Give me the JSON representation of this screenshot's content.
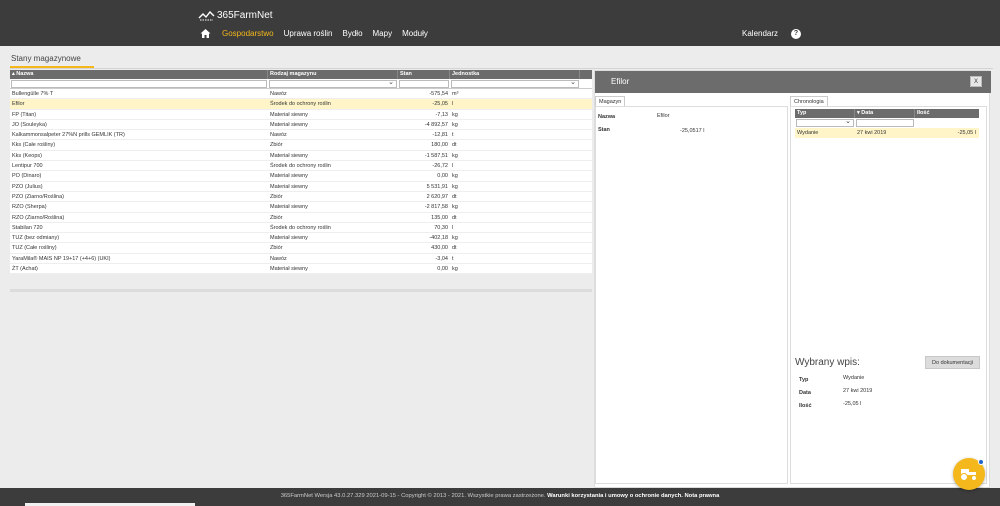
{
  "app": {
    "brand": "365FarmNet"
  },
  "nav": {
    "items": [
      "Gospodarstwo",
      "Uprawa roślin",
      "Bydło",
      "Mapy",
      "Moduły"
    ],
    "active": "Gospodarstwo",
    "calendar": "Kalendarz",
    "help": "?"
  },
  "page": {
    "title": "Stany magazynowe"
  },
  "grid": {
    "columns": [
      "Nazwa",
      "Rodzaj magazynu",
      "Stan",
      "Jednostka"
    ],
    "rows": [
      [
        "Bullengülle 7% T",
        "Nawóz",
        "-575,54",
        "m³"
      ],
      [
        "Efilor",
        "Środek do ochrony roślin",
        "-25,05",
        "l"
      ],
      [
        "FP (Titan)",
        "Materiał siewny",
        "-7,13",
        "kg"
      ],
      [
        "JO (Souleyka)",
        "Materiał siewny",
        "-4 892,57",
        "kg"
      ],
      [
        "Kalkammonsalpeter 27%N prills GEMLIK (TR)",
        "Nawóz",
        "-12,81",
        "t"
      ],
      [
        "Kks (Całe rośliny)",
        "Zbiór",
        "180,00",
        "dt"
      ],
      [
        "Kks (Keops)",
        "Materiał siewny",
        "-1 587,51",
        "kg"
      ],
      [
        "Lentipur 700",
        "Środek do ochrony roślin",
        "-26,72",
        "l"
      ],
      [
        "PO (Dinaro)",
        "Materiał siewny",
        "0,00",
        "kg"
      ],
      [
        "PZO (Julius)",
        "Materiał siewny",
        "5 531,91",
        "kg"
      ],
      [
        "PZO (Ziarno/Roślina)",
        "Zbiór",
        "2 620,97",
        "dt"
      ],
      [
        "RZO (Sherpa)",
        "Materiał siewny",
        "-2 817,58",
        "kg"
      ],
      [
        "RZO (Ziarno/Roślina)",
        "Zbiór",
        "135,00",
        "dt"
      ],
      [
        "Stabilan 720",
        "Środek do ochrony roślin",
        "70,30",
        "l"
      ],
      [
        "TUZ (bez odmiany)",
        "Materiał siewny",
        "-402,18",
        "kg"
      ],
      [
        "TUZ (Całe rośliny)",
        "Zbiór",
        "430,00",
        "dt"
      ],
      [
        "YaraMila® MAIS NP 19+17 (+4+6) (UKI)",
        "Nawóz",
        "-3,04",
        "t"
      ],
      [
        "ŻT (Achat)",
        "Materiał siewny",
        "0,00",
        "kg"
      ]
    ],
    "selected_index": 1
  },
  "detail": {
    "title": "Efilor",
    "close": "X",
    "tab_left": "Magazyn",
    "tab_right": "Chronologia",
    "nazwa_label": "Nazwa",
    "nazwa_value": "Efilor",
    "stan_label": "Stan",
    "stan_value": "-25,0517 l",
    "history": {
      "columns": [
        "Typ",
        "Data",
        "Ilość"
      ],
      "rows": [
        [
          "Wydanie",
          "27 kwi 2019",
          "-25,05 l"
        ]
      ]
    },
    "selected_entry": {
      "title": "Wybrany wpis:",
      "button": "Do dokumentacji",
      "typ_label": "Typ",
      "typ_value": "Wydanie",
      "data_label": "Data",
      "data_value": "27 kwi 2019",
      "ilosc_label": "Ilość",
      "ilosc_value": "-25,05 l"
    }
  },
  "footer": {
    "text": "365FarmNet Wersja 43.0.27.329 2021-09-15 - Copyright © 2013 - 2021. Wszystkie prawa zastrzeżone.",
    "link1": "Warunki korzystania i umowy o ochronie danych.",
    "link2": "Nota prawna"
  },
  "colors": {
    "accent": "#f5b81c",
    "header_bg": "#3c3c3c",
    "selected_row": "#fff5c8",
    "fab_dot": "#1e63c8"
  },
  "icons": [
    "farm-logo-icon",
    "home-icon",
    "help-icon",
    "printer-icon",
    "sort-asc-icon",
    "sort-desc-icon",
    "close-icon",
    "tractor-icon"
  ]
}
